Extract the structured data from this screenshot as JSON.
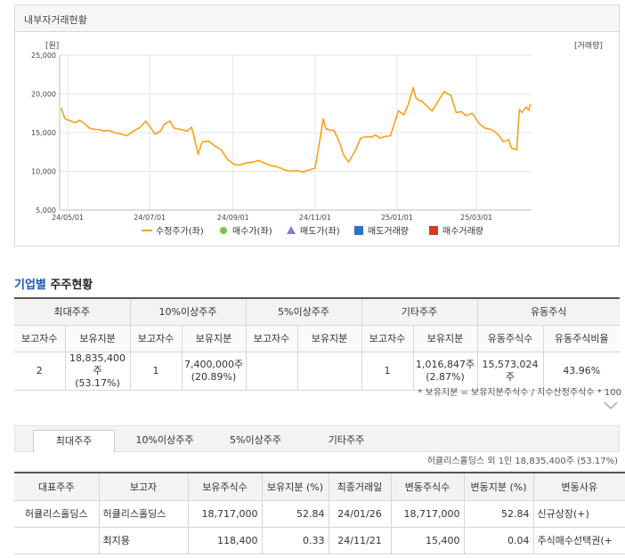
{
  "chart_panel": {
    "title": "내부자거래현황"
  },
  "chart_data": {
    "type": "line",
    "y_unit_left": "[원]",
    "y_unit_right": "[거래량]",
    "ylim": [
      5000,
      25000
    ],
    "y_ticks": [
      "25,000",
      "20,000",
      "15,000",
      "10,000",
      "5,000"
    ],
    "y_tick_values": [
      25000,
      20000,
      15000,
      10000,
      5000
    ],
    "x_ticks": [
      "24/05/01",
      "24/07/01",
      "24/09/01",
      "24/11/01",
      "25/01/01",
      "25/03/01"
    ],
    "x_tick_dates": [
      "2024-05-01",
      "2024-07-01",
      "2024-09-01",
      "2024-11-01",
      "2025-01-01",
      "2025-03-01"
    ],
    "xlim": [
      "2024-04-25",
      "2025-04-11"
    ],
    "grid": true,
    "line_color": "#f7a11a",
    "legend": [
      {
        "label": "수정주가(좌)",
        "marker": "line",
        "color": "#f7a11a"
      },
      {
        "label": "매수가(좌)",
        "marker": "circle",
        "color": "#7dc242"
      },
      {
        "label": "매도가(좌)",
        "marker": "triangle",
        "color": "#8a78c9"
      },
      {
        "label": "매도거래량",
        "marker": "square",
        "color": "#2f6fd1"
      },
      {
        "label": "매수거래량",
        "marker": "square",
        "color": "#d93a1e"
      }
    ],
    "series": [
      {
        "x": [
          "2024-04-26",
          "2024-04-29",
          "2024-05-03",
          "2024-05-07",
          "2024-05-10",
          "2024-05-14",
          "2024-05-17",
          "2024-05-21",
          "2024-05-24",
          "2024-05-28",
          "2024-05-31",
          "2024-06-05",
          "2024-06-10",
          "2024-06-14",
          "2024-06-19",
          "2024-06-24",
          "2024-06-28",
          "2024-07-03",
          "2024-07-05",
          "2024-07-09",
          "2024-07-12",
          "2024-07-16",
          "2024-07-19",
          "2024-07-24",
          "2024-07-29",
          "2024-08-01",
          "2024-08-03",
          "2024-08-06",
          "2024-08-09",
          "2024-08-14",
          "2024-08-19",
          "2024-08-23",
          "2024-08-28",
          "2024-09-02",
          "2024-09-06",
          "2024-09-11",
          "2024-09-16",
          "2024-09-20",
          "2024-09-25",
          "2024-09-30",
          "2024-10-04",
          "2024-10-09",
          "2024-10-14",
          "2024-10-18",
          "2024-10-23",
          "2024-10-28",
          "2024-11-01",
          "2024-11-05",
          "2024-11-07",
          "2024-11-09",
          "2024-11-12",
          "2024-11-15",
          "2024-11-19",
          "2024-11-22",
          "2024-11-26",
          "2024-12-01",
          "2024-12-05",
          "2024-12-10",
          "2024-12-13",
          "2024-12-16",
          "2024-12-19",
          "2024-12-23",
          "2024-12-27",
          "2025-01-02",
          "2025-01-06",
          "2025-01-09",
          "2025-01-10",
          "2025-01-13",
          "2025-01-15",
          "2025-01-17",
          "2025-01-20",
          "2025-01-22",
          "2025-01-27",
          "2025-02-01",
          "2025-02-05",
          "2025-02-10",
          "2025-02-14",
          "2025-02-18",
          "2025-02-21",
          "2025-02-26",
          "2025-03-03",
          "2025-03-07",
          "2025-03-12",
          "2025-03-17",
          "2025-03-21",
          "2025-03-25",
          "2025-03-27",
          "2025-03-31",
          "2025-04-02",
          "2025-04-04",
          "2025-04-07",
          "2025-04-09",
          "2025-04-10"
        ],
        "values": [
          18200,
          16800,
          16500,
          16300,
          16600,
          16100,
          15600,
          15400,
          15400,
          15200,
          15300,
          15000,
          14800,
          14600,
          15200,
          15700,
          16500,
          15300,
          14800,
          15200,
          16100,
          16500,
          15600,
          15400,
          15200,
          15700,
          14500,
          12200,
          13800,
          13900,
          13200,
          12800,
          11500,
          10900,
          10800,
          11100,
          11200,
          11400,
          11000,
          10700,
          10600,
          10200,
          10000,
          10100,
          9900,
          10200,
          10400,
          14500,
          16800,
          15500,
          15300,
          15300,
          13800,
          12200,
          11200,
          12700,
          14300,
          14500,
          14400,
          14700,
          14300,
          14500,
          14600,
          17800,
          17300,
          18500,
          19000,
          20800,
          19500,
          19200,
          19000,
          18600,
          17800,
          19200,
          20300,
          19800,
          17600,
          17700,
          17200,
          17500,
          16200,
          15600,
          15400,
          14800,
          13800,
          14100,
          13000,
          12800,
          18000,
          17600,
          18300,
          17900,
          18700
        ]
      }
    ]
  },
  "section": {
    "title_blue": "기업별",
    "title_rest": " 주주현황"
  },
  "summary_table": {
    "groups": [
      "최대주주",
      "10%이상주주",
      "5%이상주주",
      "기타주주",
      "유동주식"
    ],
    "subheaders": [
      "보고자수",
      "보유지분",
      "보고자수",
      "보유지분",
      "보고자수",
      "보유지분",
      "보고자수",
      "보유지분",
      "유동주식수",
      "유동주식비율"
    ],
    "row": [
      {
        "line1": "2",
        "line2": ""
      },
      {
        "line1": "18,835,400주",
        "line2": "(53.17%)"
      },
      {
        "line1": "1",
        "line2": ""
      },
      {
        "line1": "7,400,000주",
        "line2": "(20.89%)"
      },
      {
        "line1": "",
        "line2": ""
      },
      {
        "line1": "",
        "line2": ""
      },
      {
        "line1": "1",
        "line2": ""
      },
      {
        "line1": "1,016,847주",
        "line2": "(2.87%)"
      },
      {
        "line1": "15,573,024주",
        "line2": ""
      },
      {
        "line1": "43.96%",
        "line2": ""
      }
    ],
    "footnote": "* 보유지분 = 보유지분주식수 / 지수산정주식수 * 100"
  },
  "tabs": {
    "items": [
      "최대주주",
      "10%이상주주",
      "5%이상주주",
      "기타주주"
    ],
    "active": 0
  },
  "holder_summary": "허큘리스홀딩스 외 1인 18,835,400주 (53.17%)",
  "detail_table": {
    "headers": [
      "대표주주",
      "보고자",
      "보유주식수",
      "보유지분 (%)",
      "최종거래일",
      "변동주식수",
      "변동지분 (%)",
      "변동사유"
    ],
    "rows": [
      [
        "허큘리스홀딩스",
        "허큘리스홀딩스",
        "18,717,000",
        "52.84",
        "24/01/26",
        "18,717,000",
        "52.84",
        "신규상장(+)"
      ],
      [
        "",
        "최지용",
        "118,400",
        "0.33",
        "24/11/21",
        "15,400",
        "0.04",
        "주식매수선택권(+"
      ]
    ]
  }
}
